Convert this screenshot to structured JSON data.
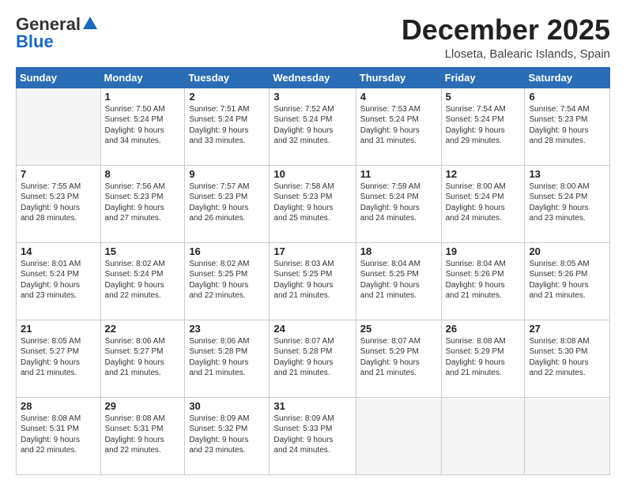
{
  "header": {
    "logo_general": "General",
    "logo_blue": "Blue",
    "month_title": "December 2025",
    "location": "Lloseta, Balearic Islands, Spain"
  },
  "weekdays": [
    "Sunday",
    "Monday",
    "Tuesday",
    "Wednesday",
    "Thursday",
    "Friday",
    "Saturday"
  ],
  "weeks": [
    [
      {
        "day": "",
        "info": ""
      },
      {
        "day": "1",
        "info": "Sunrise: 7:50 AM\nSunset: 5:24 PM\nDaylight: 9 hours\nand 34 minutes."
      },
      {
        "day": "2",
        "info": "Sunrise: 7:51 AM\nSunset: 5:24 PM\nDaylight: 9 hours\nand 33 minutes."
      },
      {
        "day": "3",
        "info": "Sunrise: 7:52 AM\nSunset: 5:24 PM\nDaylight: 9 hours\nand 32 minutes."
      },
      {
        "day": "4",
        "info": "Sunrise: 7:53 AM\nSunset: 5:24 PM\nDaylight: 9 hours\nand 31 minutes."
      },
      {
        "day": "5",
        "info": "Sunrise: 7:54 AM\nSunset: 5:24 PM\nDaylight: 9 hours\nand 29 minutes."
      },
      {
        "day": "6",
        "info": "Sunrise: 7:54 AM\nSunset: 5:23 PM\nDaylight: 9 hours\nand 28 minutes."
      }
    ],
    [
      {
        "day": "7",
        "info": "Sunrise: 7:55 AM\nSunset: 5:23 PM\nDaylight: 9 hours\nand 28 minutes."
      },
      {
        "day": "8",
        "info": "Sunrise: 7:56 AM\nSunset: 5:23 PM\nDaylight: 9 hours\nand 27 minutes."
      },
      {
        "day": "9",
        "info": "Sunrise: 7:57 AM\nSunset: 5:23 PM\nDaylight: 9 hours\nand 26 minutes."
      },
      {
        "day": "10",
        "info": "Sunrise: 7:58 AM\nSunset: 5:23 PM\nDaylight: 9 hours\nand 25 minutes."
      },
      {
        "day": "11",
        "info": "Sunrise: 7:59 AM\nSunset: 5:24 PM\nDaylight: 9 hours\nand 24 minutes."
      },
      {
        "day": "12",
        "info": "Sunrise: 8:00 AM\nSunset: 5:24 PM\nDaylight: 9 hours\nand 24 minutes."
      },
      {
        "day": "13",
        "info": "Sunrise: 8:00 AM\nSunset: 5:24 PM\nDaylight: 9 hours\nand 23 minutes."
      }
    ],
    [
      {
        "day": "14",
        "info": "Sunrise: 8:01 AM\nSunset: 5:24 PM\nDaylight: 9 hours\nand 23 minutes."
      },
      {
        "day": "15",
        "info": "Sunrise: 8:02 AM\nSunset: 5:24 PM\nDaylight: 9 hours\nand 22 minutes."
      },
      {
        "day": "16",
        "info": "Sunrise: 8:02 AM\nSunset: 5:25 PM\nDaylight: 9 hours\nand 22 minutes."
      },
      {
        "day": "17",
        "info": "Sunrise: 8:03 AM\nSunset: 5:25 PM\nDaylight: 9 hours\nand 21 minutes."
      },
      {
        "day": "18",
        "info": "Sunrise: 8:04 AM\nSunset: 5:25 PM\nDaylight: 9 hours\nand 21 minutes."
      },
      {
        "day": "19",
        "info": "Sunrise: 8:04 AM\nSunset: 5:26 PM\nDaylight: 9 hours\nand 21 minutes."
      },
      {
        "day": "20",
        "info": "Sunrise: 8:05 AM\nSunset: 5:26 PM\nDaylight: 9 hours\nand 21 minutes."
      }
    ],
    [
      {
        "day": "21",
        "info": "Sunrise: 8:05 AM\nSunset: 5:27 PM\nDaylight: 9 hours\nand 21 minutes."
      },
      {
        "day": "22",
        "info": "Sunrise: 8:06 AM\nSunset: 5:27 PM\nDaylight: 9 hours\nand 21 minutes."
      },
      {
        "day": "23",
        "info": "Sunrise: 8:06 AM\nSunset: 5:28 PM\nDaylight: 9 hours\nand 21 minutes."
      },
      {
        "day": "24",
        "info": "Sunrise: 8:07 AM\nSunset: 5:28 PM\nDaylight: 9 hours\nand 21 minutes."
      },
      {
        "day": "25",
        "info": "Sunrise: 8:07 AM\nSunset: 5:29 PM\nDaylight: 9 hours\nand 21 minutes."
      },
      {
        "day": "26",
        "info": "Sunrise: 8:08 AM\nSunset: 5:29 PM\nDaylight: 9 hours\nand 21 minutes."
      },
      {
        "day": "27",
        "info": "Sunrise: 8:08 AM\nSunset: 5:30 PM\nDaylight: 9 hours\nand 22 minutes."
      }
    ],
    [
      {
        "day": "28",
        "info": "Sunrise: 8:08 AM\nSunset: 5:31 PM\nDaylight: 9 hours\nand 22 minutes."
      },
      {
        "day": "29",
        "info": "Sunrise: 8:08 AM\nSunset: 5:31 PM\nDaylight: 9 hours\nand 22 minutes."
      },
      {
        "day": "30",
        "info": "Sunrise: 8:09 AM\nSunset: 5:32 PM\nDaylight: 9 hours\nand 23 minutes."
      },
      {
        "day": "31",
        "info": "Sunrise: 8:09 AM\nSunset: 5:33 PM\nDaylight: 9 hours\nand 24 minutes."
      },
      {
        "day": "",
        "info": ""
      },
      {
        "day": "",
        "info": ""
      },
      {
        "day": "",
        "info": ""
      }
    ]
  ]
}
